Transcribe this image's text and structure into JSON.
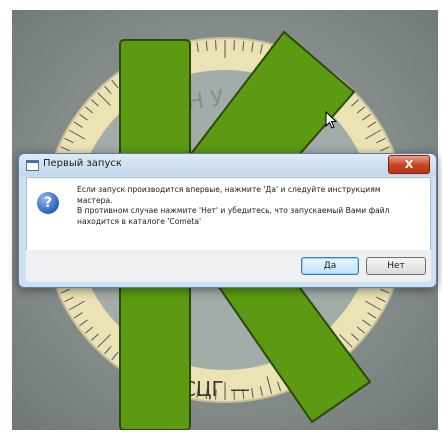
{
  "dialog": {
    "title": "Первый запуск",
    "close_label": "X",
    "icon": "question-icon",
    "message_lines": [
      "Если запуск производится впервые, нажмите 'Да' и следуйте инструкциям",
      "мастера.",
      "В противном случае нажмите 'Нет' и убедитесь, что запускаемый Вами файл",
      "находится в каталоге 'Cometa'"
    ],
    "yes_label": "Да",
    "no_label": "Нет"
  },
  "background": {
    "logo_text_top": "Н Т Р Н У",
    "logo_text_bottom": "СЦГ —",
    "colors": {
      "green": "#5b9a12",
      "ring": "#ece3b5",
      "backdrop": "#8a9390"
    }
  }
}
